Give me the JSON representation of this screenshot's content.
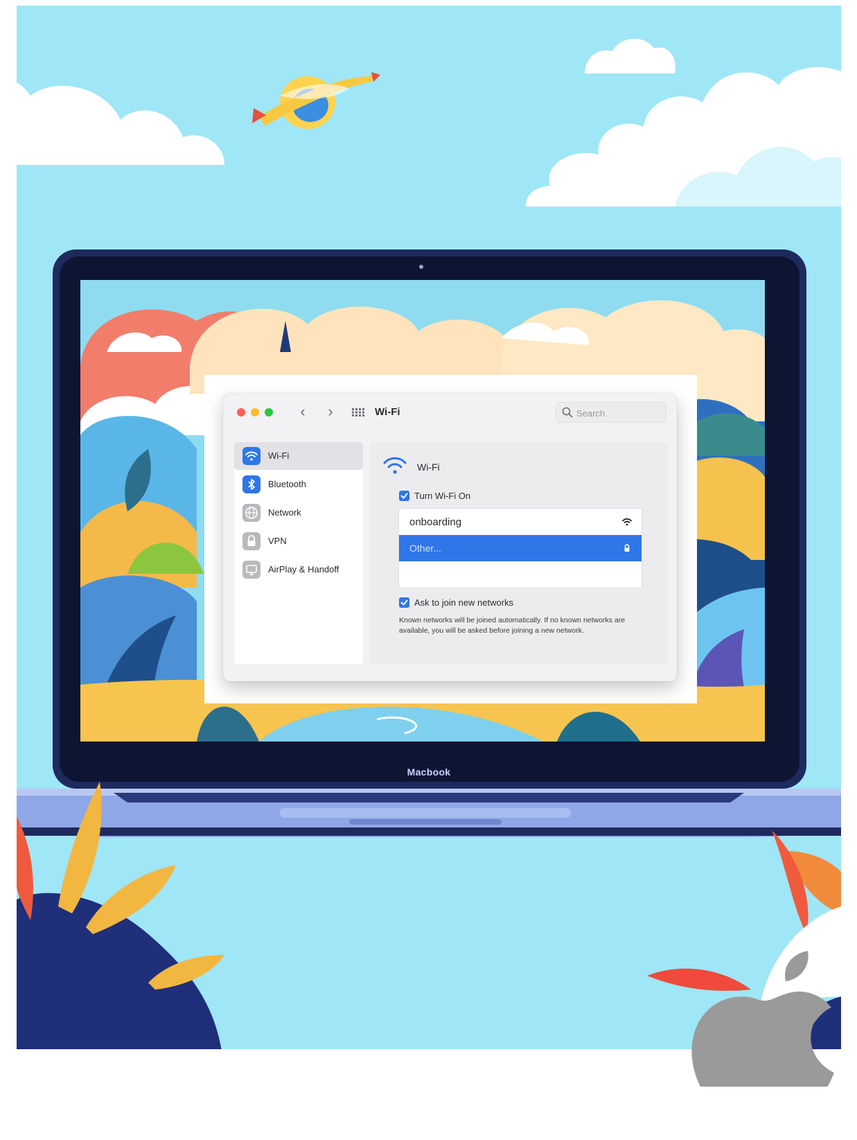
{
  "window": {
    "title": "Wi-Fi",
    "search_placeholder": "Search",
    "nav_back": "‹",
    "nav_forward": "›"
  },
  "sidebar": {
    "items": [
      {
        "label": "Wi-Fi",
        "icon": "wifi-icon",
        "color": "#2f76e8",
        "selected": true
      },
      {
        "label": "Bluetooth",
        "icon": "bluetooth-icon",
        "color": "#2f76e8",
        "selected": false
      },
      {
        "label": "Network",
        "icon": "globe-icon",
        "color": "#b9b9be",
        "selected": false
      },
      {
        "label": "VPN",
        "icon": "lock-icon",
        "color": "#b9b9be",
        "selected": false
      },
      {
        "label": "AirPlay & Handoff",
        "icon": "airplay-icon",
        "color": "#b9b9be",
        "selected": false
      }
    ]
  },
  "content": {
    "title": "Wi-Fi",
    "turn_on_label": "Turn Wi-Fi On",
    "turn_on_checked": true,
    "networks": [
      {
        "name": "onboarding",
        "icon": "wifi-signal-icon",
        "selected": false
      },
      {
        "name": "Other...",
        "icon": "lock-icon",
        "selected": true
      }
    ],
    "ask_label": "Ask to join new networks",
    "ask_checked": true,
    "help_text": "Known networks will be joined automatically. If no known networks are available, you will be asked before joining a new network."
  },
  "device_label": "Macbook",
  "colors": {
    "accent": "#2f76e8",
    "sky": "#9fe6f7",
    "laptop_frame": "#1e2a5e"
  }
}
